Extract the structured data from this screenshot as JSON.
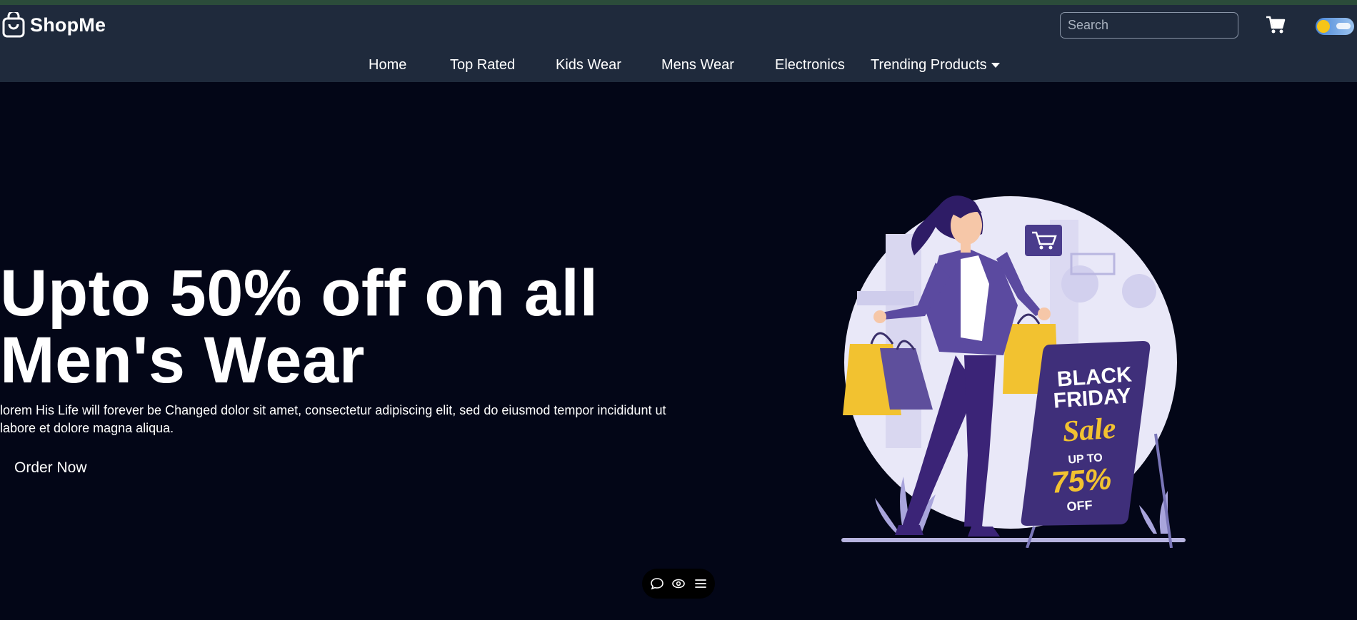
{
  "brand": {
    "name": "ShopMe",
    "icon": "shopping-bag-icon"
  },
  "search": {
    "placeholder": "Search",
    "value": ""
  },
  "header_icons": {
    "cart": "cart-icon",
    "theme_toggle": "theme-toggle"
  },
  "nav": {
    "items": [
      {
        "label": "Home"
      },
      {
        "label": "Top Rated"
      },
      {
        "label": "Kids Wear"
      },
      {
        "label": "Mens Wear"
      },
      {
        "label": "Electronics"
      },
      {
        "label": "Trending Products"
      }
    ]
  },
  "hero": {
    "title_line1": "Upto 50% off on all",
    "title_line2": "Men's Wear",
    "description": "lorem His Life will forever be Changed dolor sit amet, consectetur adipiscing elit, sed do eiusmod tempor incididunt ut labore et dolore magna aliqua.",
    "cta_label": "Order Now"
  },
  "illustration": {
    "sign_line1": "BLACK",
    "sign_line2": "FRIDAY",
    "sign_line3": "Sale",
    "sign_line4": "UP TO",
    "sign_line5": "75%",
    "sign_line6": "OFF"
  },
  "floating_toolbar": {
    "icons": [
      "chat-icon",
      "eye-icon",
      "menu-icon"
    ]
  },
  "colors": {
    "background": "#030617",
    "header": "#1f2a3c",
    "accent_yellow": "#f5c518",
    "illustration_purple": "#3f2f7a"
  }
}
